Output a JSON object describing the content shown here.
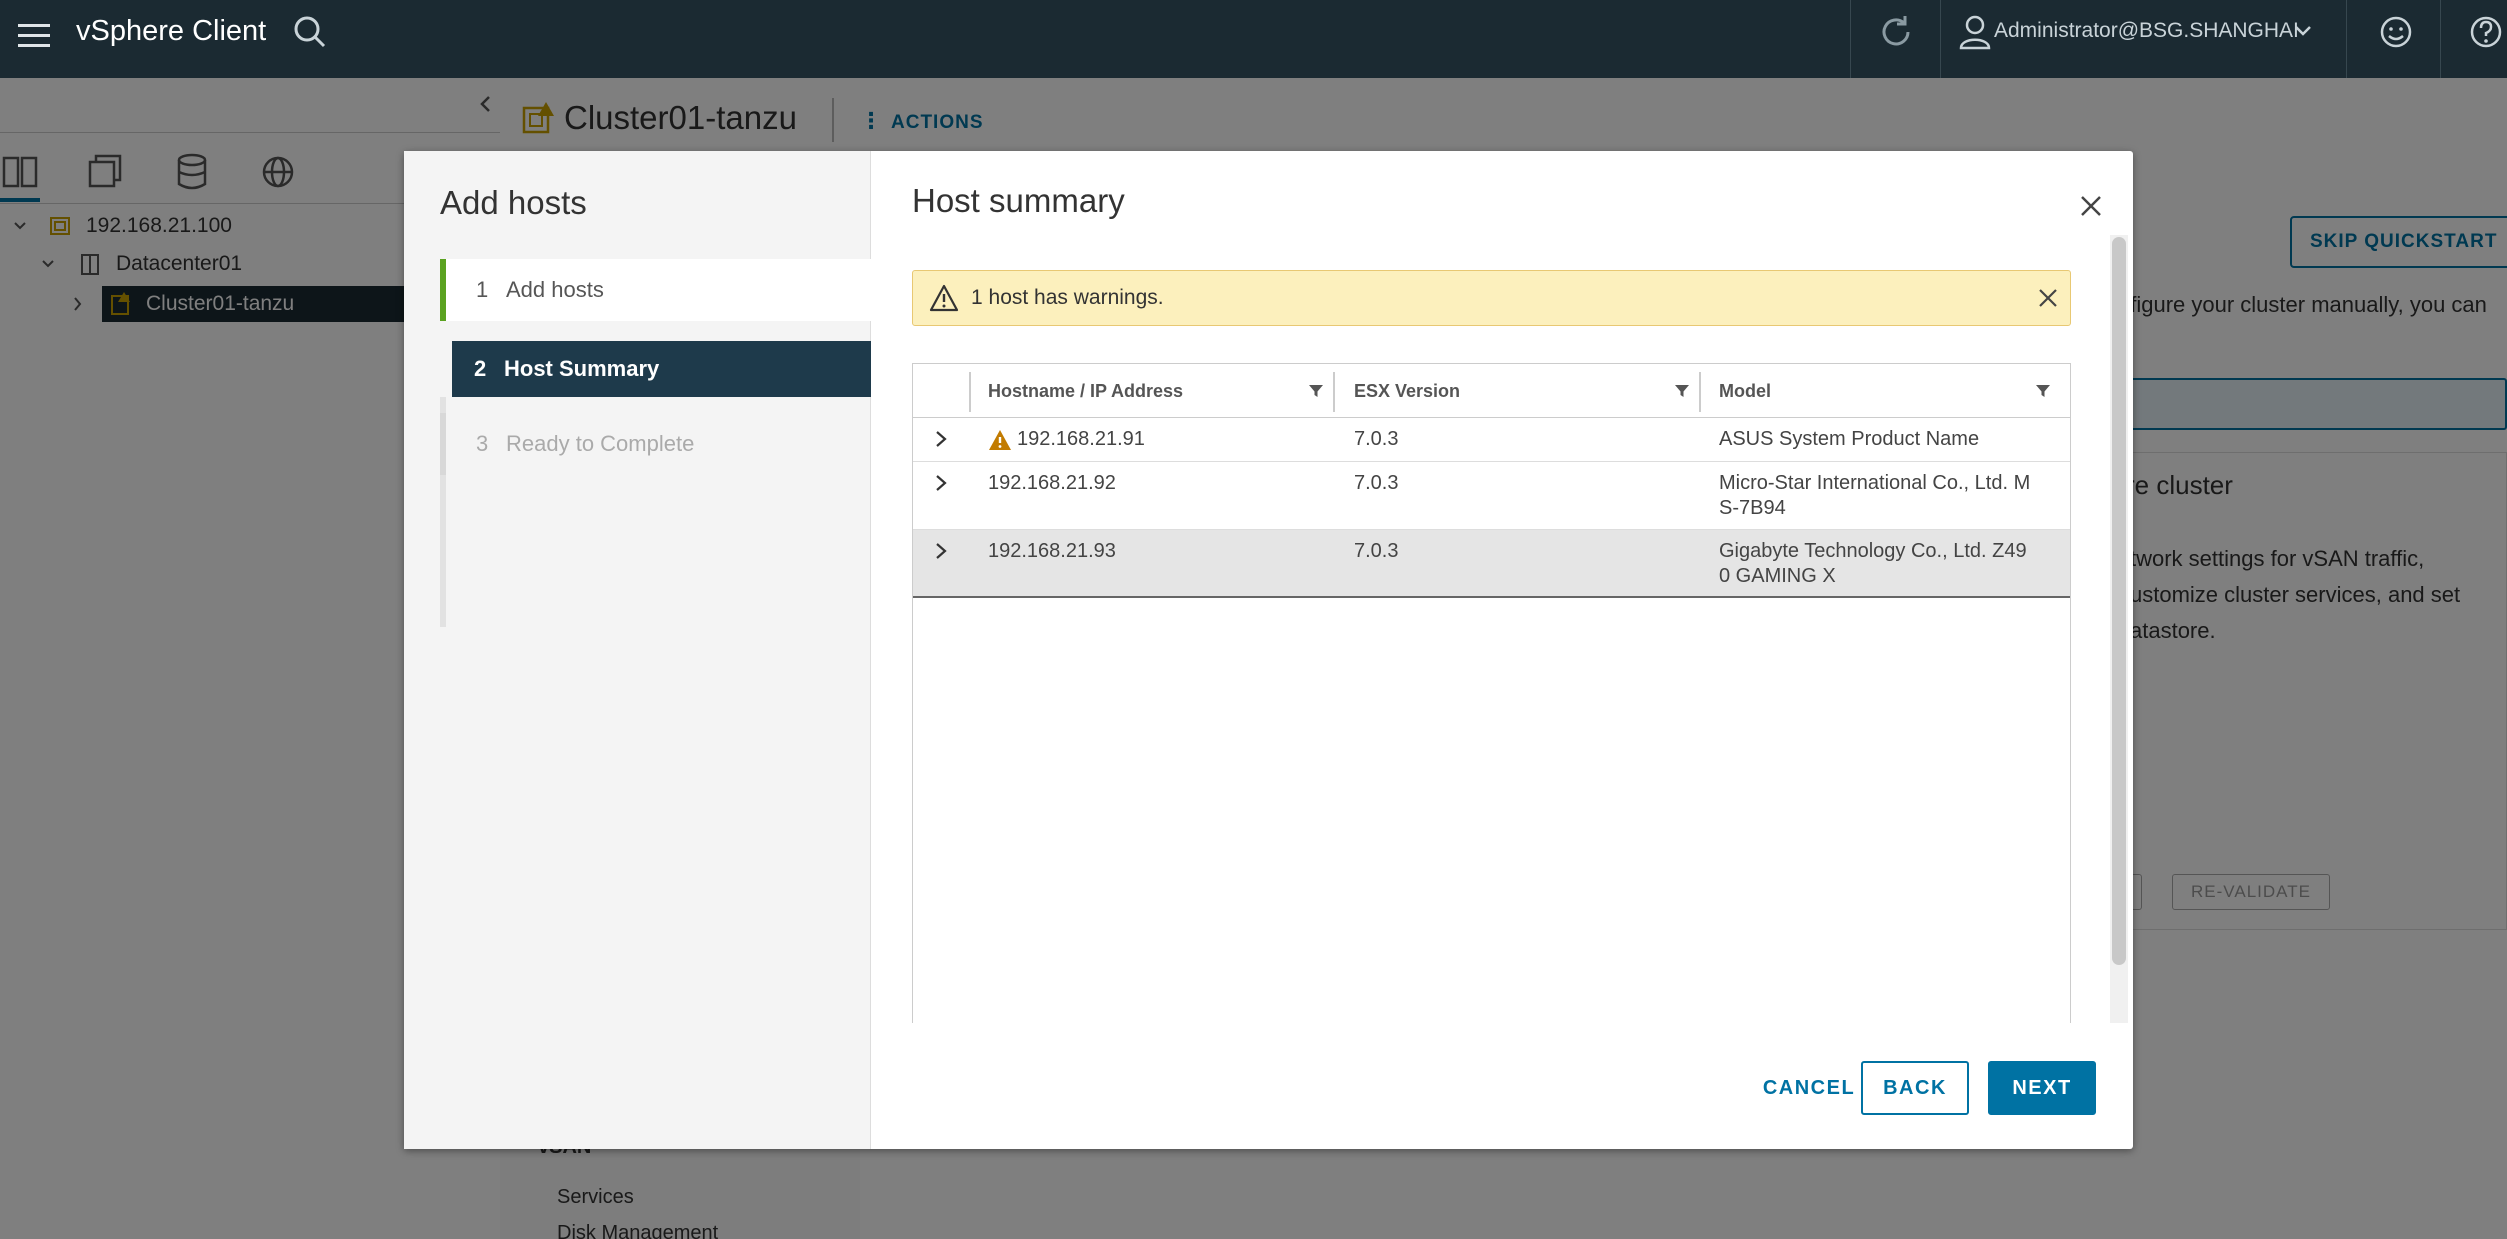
{
  "header": {
    "app_title": "vSphere Client",
    "user": "Administrator@BSG.SHANGHAI"
  },
  "background": {
    "tree": {
      "vcenter": "192.168.21.100",
      "datacenter": "Datacenter01",
      "cluster": "Cluster01-tanzu"
    },
    "page_title": "Cluster01-tanzu",
    "actions_label": "ACTIONS",
    "skip_quickstart": "SKIP QUICKSTART",
    "manual_text": "nfigure your cluster manually, you can",
    "card_title": "re cluster",
    "card_lines": [
      "twork settings for vSAN traffic,",
      "ustomize cluster services, and set",
      "atastore."
    ],
    "revalidate": "RE-VALIDATE",
    "sidebar_section": "vSAN",
    "sidebar_items": [
      "Services",
      "Disk Management"
    ]
  },
  "modal": {
    "wizard_title": "Add hosts",
    "steps": [
      {
        "num": "1",
        "label": "Add hosts"
      },
      {
        "num": "2",
        "label": "Host Summary"
      },
      {
        "num": "3",
        "label": "Ready to Complete"
      }
    ],
    "content_title": "Host summary",
    "alert_text": "1 host has warnings.",
    "grid": {
      "columns": [
        "Hostname / IP Address",
        "ESX Version",
        "Model"
      ],
      "rows": [
        {
          "host": "192.168.21.91",
          "version": "7.0.3",
          "model": "ASUS System Product Name",
          "warning": true
        },
        {
          "host": "192.168.21.92",
          "version": "7.0.3",
          "model_line1": "Micro-Star International Co., Ltd. M",
          "model_line2": "S-7B94",
          "warning": false
        },
        {
          "host": "192.168.21.93",
          "version": "7.0.3",
          "model_line1": "Gigabyte Technology Co., Ltd. Z49",
          "model_line2": "0 GAMING X",
          "warning": false
        }
      ]
    },
    "buttons": {
      "cancel": "CANCEL",
      "back": "BACK",
      "next": "NEXT"
    }
  },
  "colors": {
    "header_bg": "#1b2a32",
    "accent": "#0072a3",
    "active_step": "#1e3a4b",
    "step_done": "#5aa220",
    "warning": "#c27b00"
  }
}
